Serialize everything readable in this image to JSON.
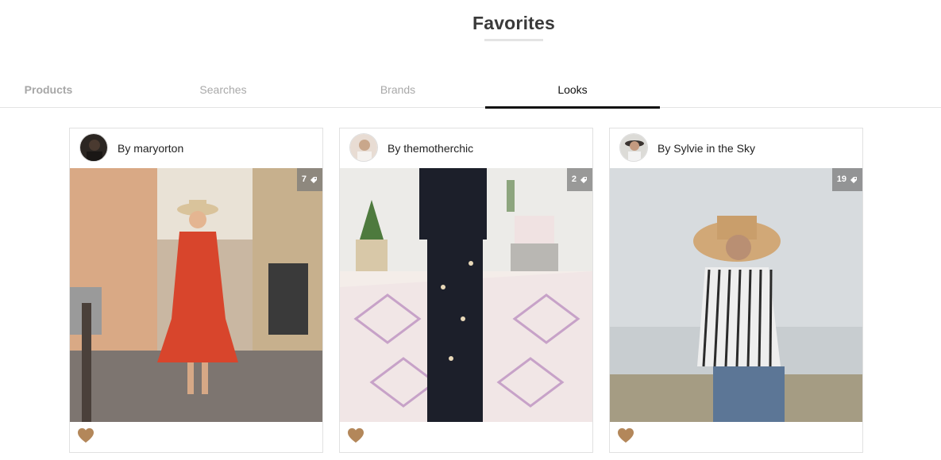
{
  "page": {
    "title": "Favorites"
  },
  "tabs": [
    {
      "label": "Products",
      "active": false
    },
    {
      "label": "Searches",
      "active": false
    },
    {
      "label": "Brands",
      "active": false
    },
    {
      "label": "Looks",
      "active": true
    }
  ],
  "cards": [
    {
      "author": "By maryorton",
      "tag_count": "7",
      "image": "Woman in red dress and sun hat on city street",
      "favorited": true
    },
    {
      "author": "By themotherchic",
      "tag_count": "2",
      "image": "Woman in floral black jumpsuit on patterned rug",
      "favorited": true
    },
    {
      "author": "By Sylvie in the Sky",
      "tag_count": "19",
      "image": "Woman in striped shirt and straw hat by the sea",
      "favorited": true
    }
  ],
  "colors": {
    "heart": "#b3875a",
    "active_tab_underline": "#111111",
    "badge_bg": "#787878"
  },
  "icons": {
    "favorite": "heart-icon",
    "tag": "tag-icon"
  }
}
